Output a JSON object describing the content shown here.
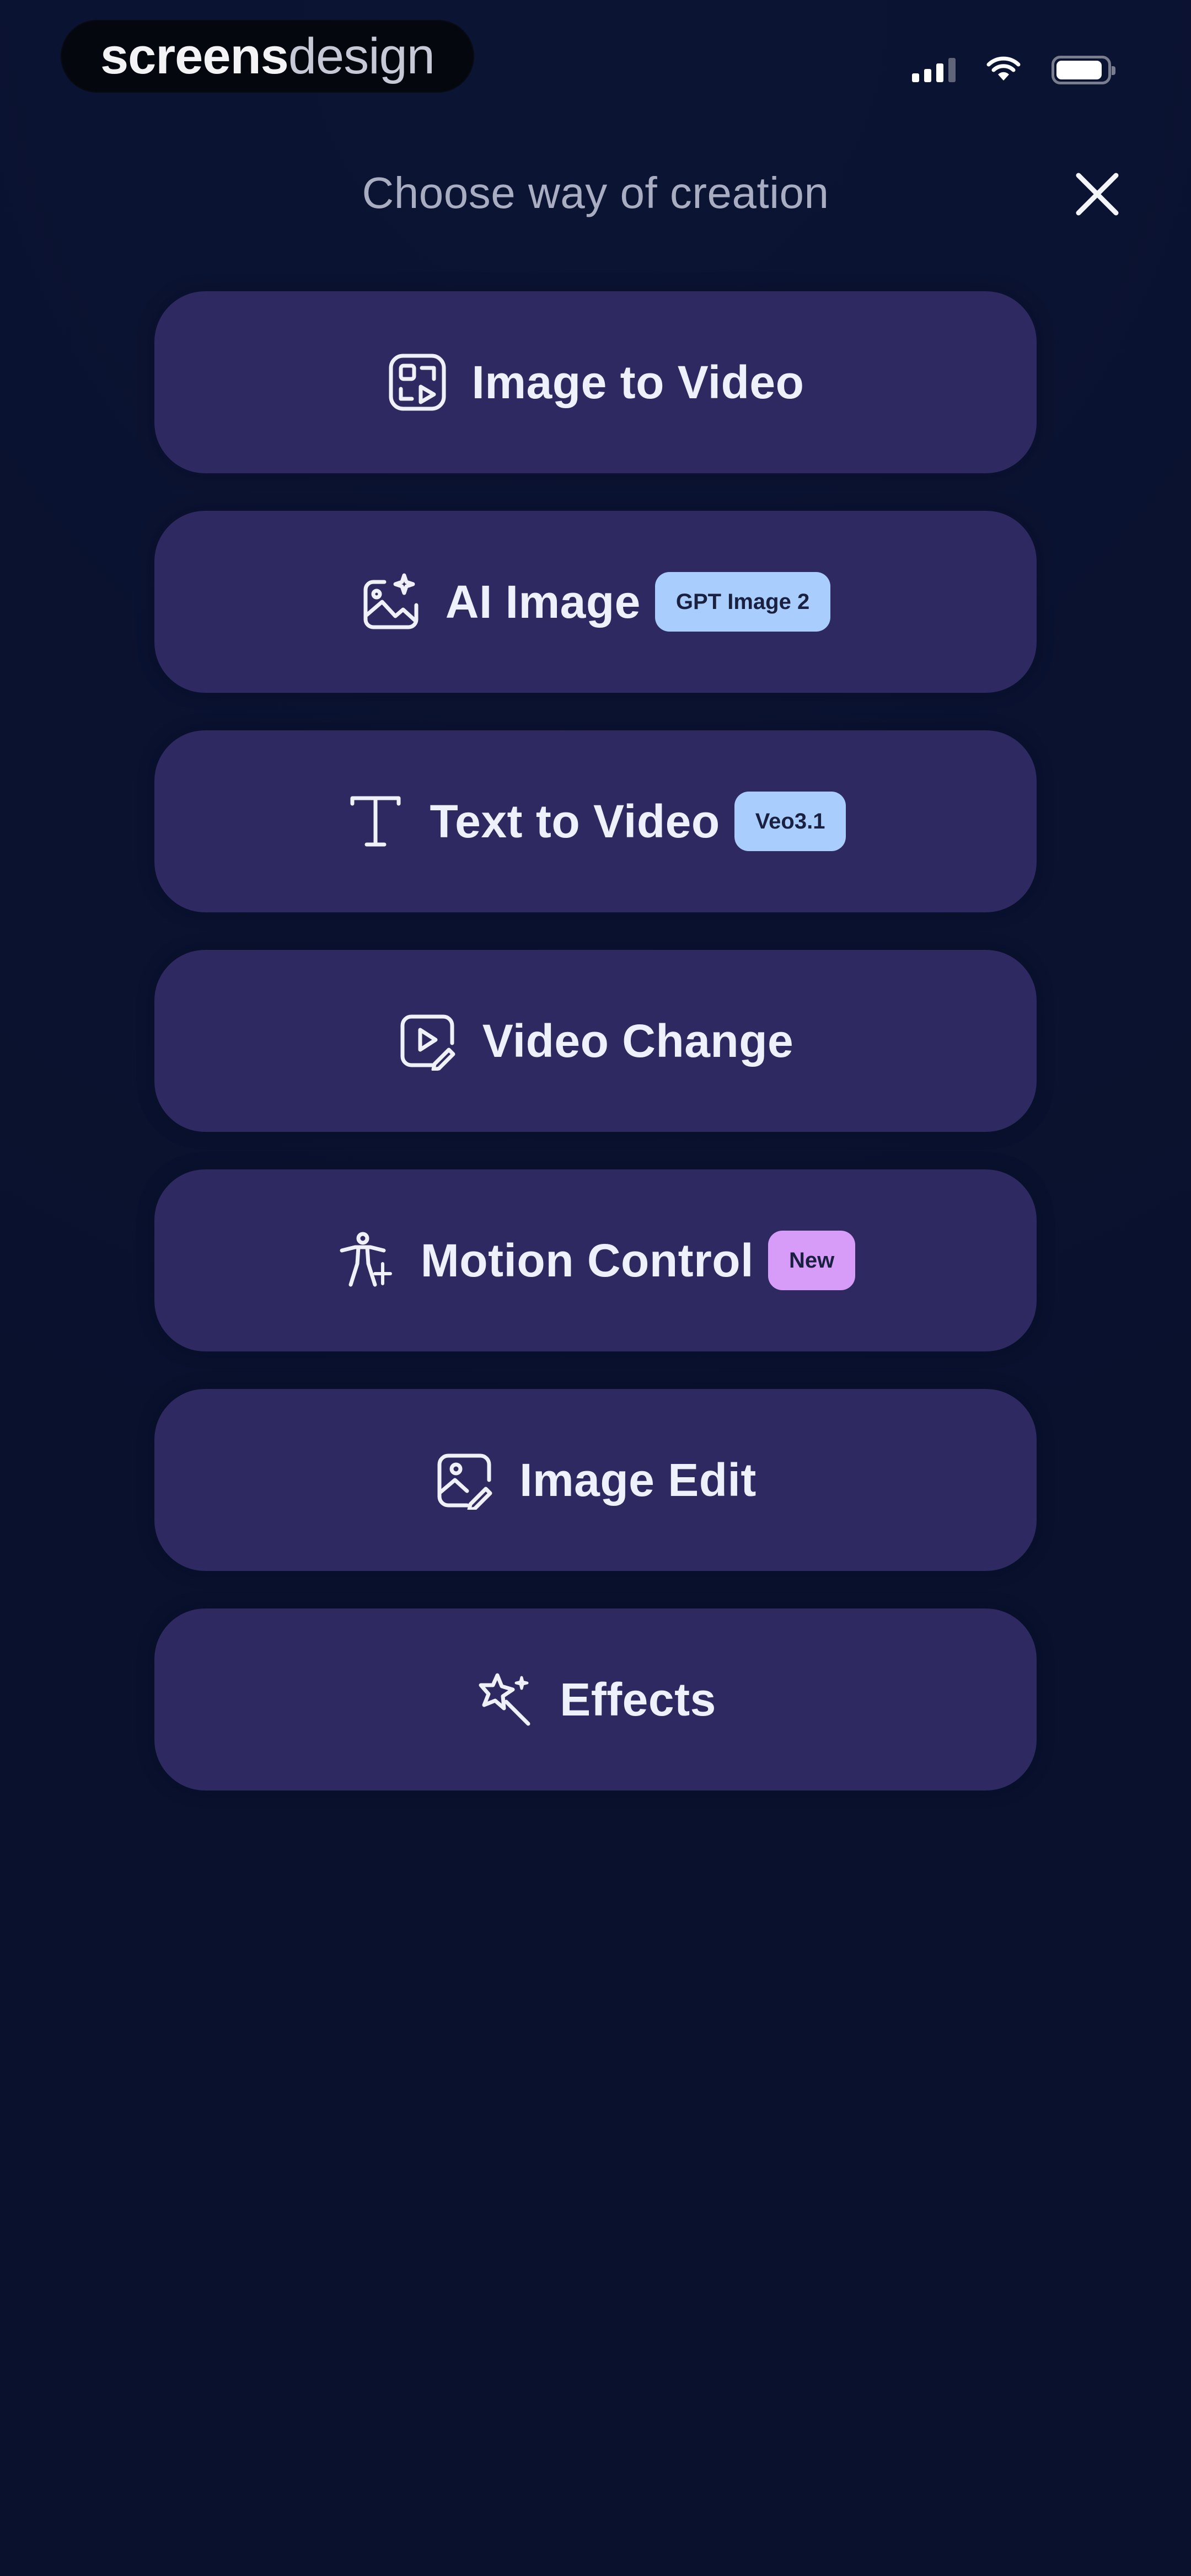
{
  "status_bar": {
    "brand_bold": "screens",
    "brand_light": "design",
    "signal_icon": "cellular-signal-icon",
    "wifi_icon": "wifi-icon",
    "battery_icon": "battery-icon"
  },
  "header": {
    "title": "Choose way of creation",
    "close_icon": "close-icon"
  },
  "options": [
    {
      "label": "Image to Video",
      "icon": "image-to-video-icon"
    },
    {
      "label": "AI Image",
      "icon": "ai-image-icon",
      "badge": "GPT Image 2"
    },
    {
      "label": "Text to Video",
      "icon": "text-icon",
      "badge": "Veo3.1"
    },
    {
      "label": "Video Change",
      "icon": "video-change-icon"
    },
    {
      "label": "Motion Control",
      "icon": "motion-control-icon",
      "badge": "New"
    },
    {
      "label": "Image Edit",
      "icon": "image-edit-icon"
    },
    {
      "label": "Effects",
      "icon": "effects-icon"
    }
  ],
  "colors": {
    "background": "#0a1230",
    "card": "#2e2a61",
    "badge_blue": "#a9cdfc",
    "badge_purple": "#d69cf7",
    "title_text": "#a9adc2",
    "label_text": "#eef0fb"
  }
}
